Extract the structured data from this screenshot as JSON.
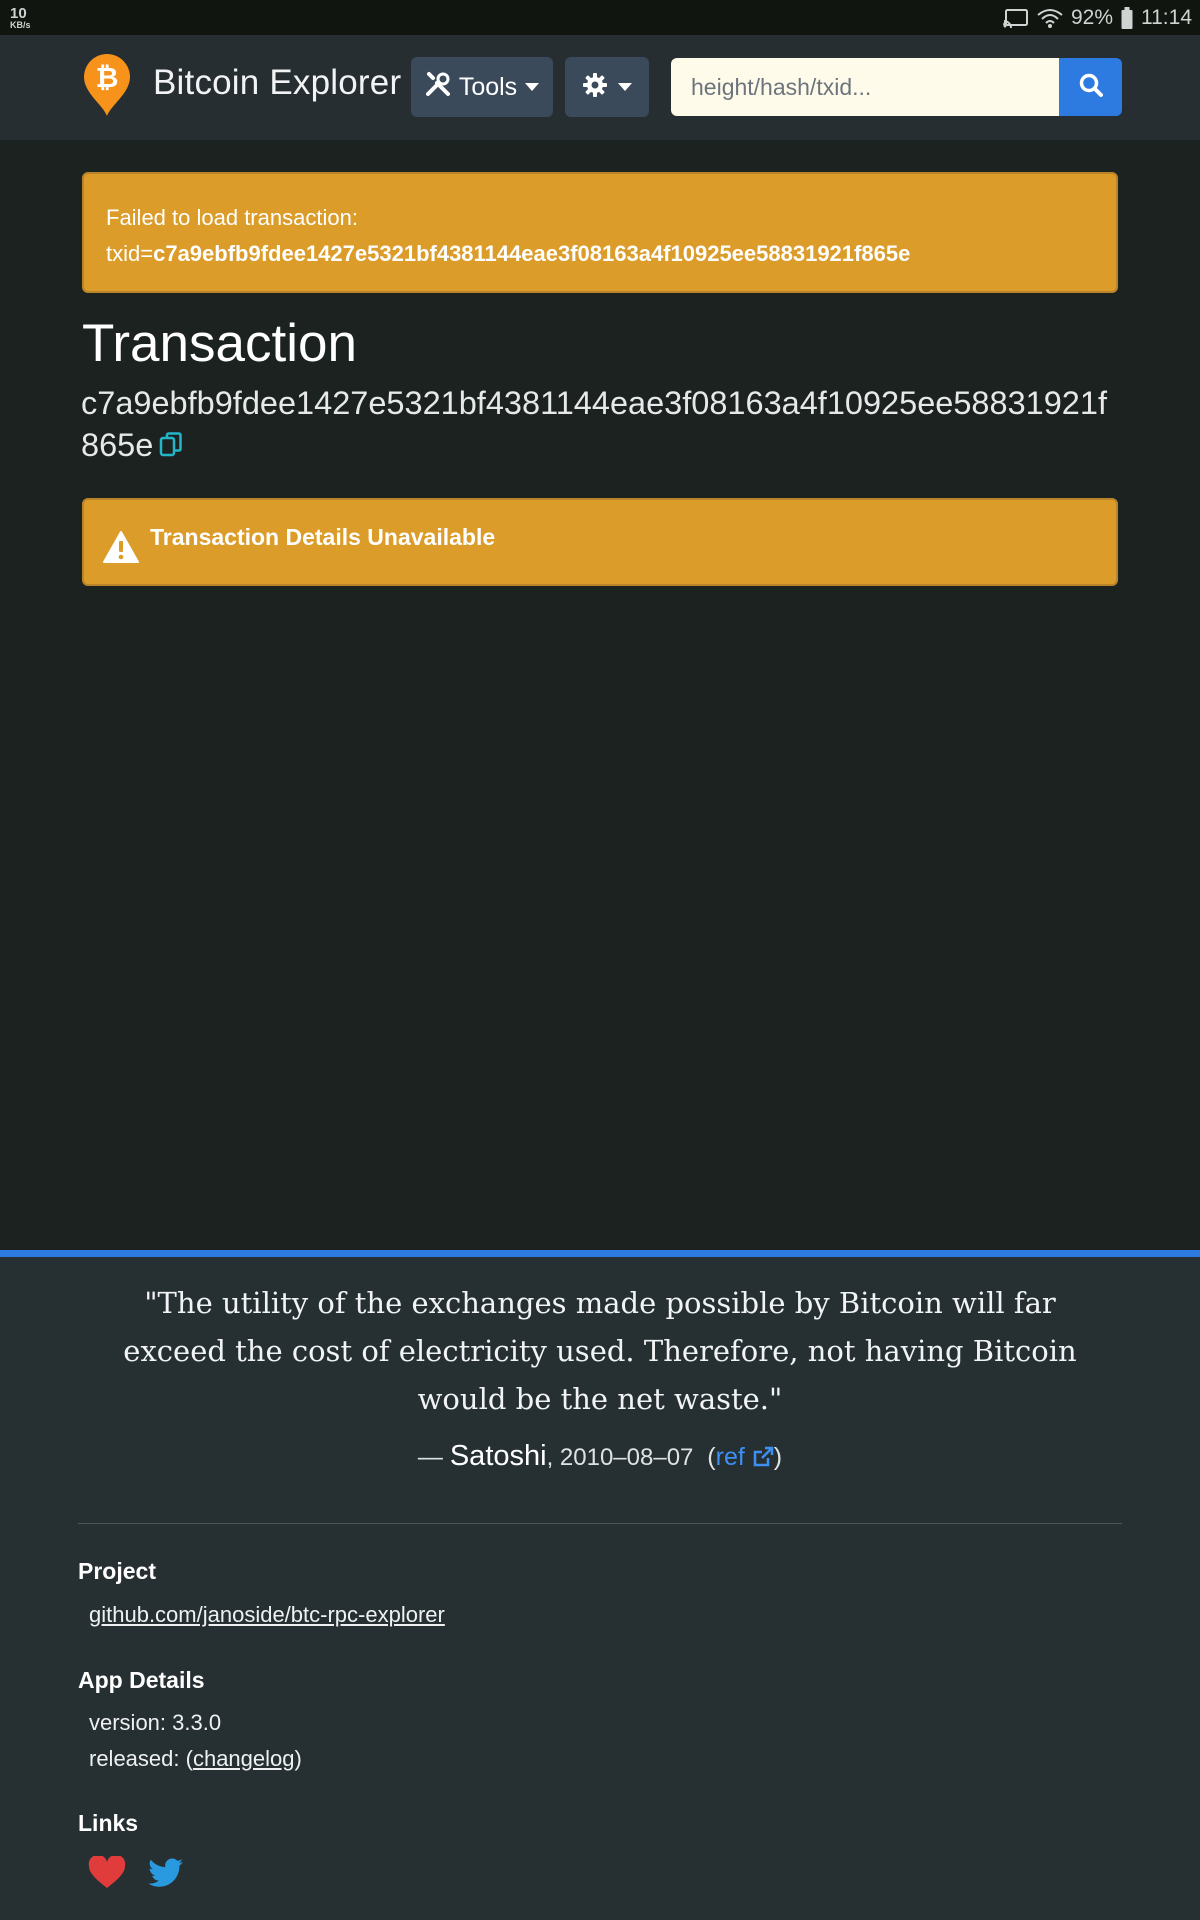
{
  "status_bar": {
    "speed_value": "10",
    "speed_unit": "KB/s",
    "battery": "92%",
    "time": "11:14"
  },
  "navbar": {
    "brand": "Bitcoin Explorer",
    "tools_label": "Tools",
    "search_placeholder": "height/hash/txid..."
  },
  "error_alert": {
    "line1": "Failed to load transaction:",
    "txid_prefix": "txid=",
    "txid": "c7a9ebfb9fdee1427e5321bf4381144eae3f08163a4f10925ee58831921f865e"
  },
  "page": {
    "title": "Transaction",
    "txid": "c7a9ebfb9fdee1427e5321bf4381144eae3f08163a4f10925ee58831921f865e"
  },
  "warning_alert": {
    "text": "Transaction Details Unavailable"
  },
  "footer": {
    "quote": "\"The utility of the exchanges made possible by Bitcoin will far exceed the cost of electricity used. Therefore, not having Bitcoin would be the net waste.\"",
    "dash": "— ",
    "author": "Satoshi",
    "date": ", 2010–08–07",
    "ref_open": "(",
    "ref_label": "ref",
    "ref_close": ")",
    "project_heading": "Project",
    "project_link": "github.com/janoside/btc-rpc-explorer",
    "app_details_heading": "App Details",
    "version_text": "version: 3.3.0",
    "released_prefix": "released: (",
    "changelog_label": "changelog",
    "released_suffix": ")",
    "links_heading": "Links"
  },
  "colors": {
    "background": "#1c2220",
    "navbar": "#272e31",
    "alert": "#dc9c2a",
    "accent": "#2d7be0",
    "bitcoin_orange": "#f7931a",
    "heart": "#e03c3c",
    "twitter": "#2a9ae0"
  },
  "icons": [
    "cast-icon",
    "wifi-icon",
    "battery-icon",
    "bitcoin-logo",
    "tools-icon",
    "gear-icon",
    "search-icon",
    "copy-icon",
    "warning-icon",
    "external-link-icon",
    "heart-icon",
    "twitter-icon"
  ]
}
